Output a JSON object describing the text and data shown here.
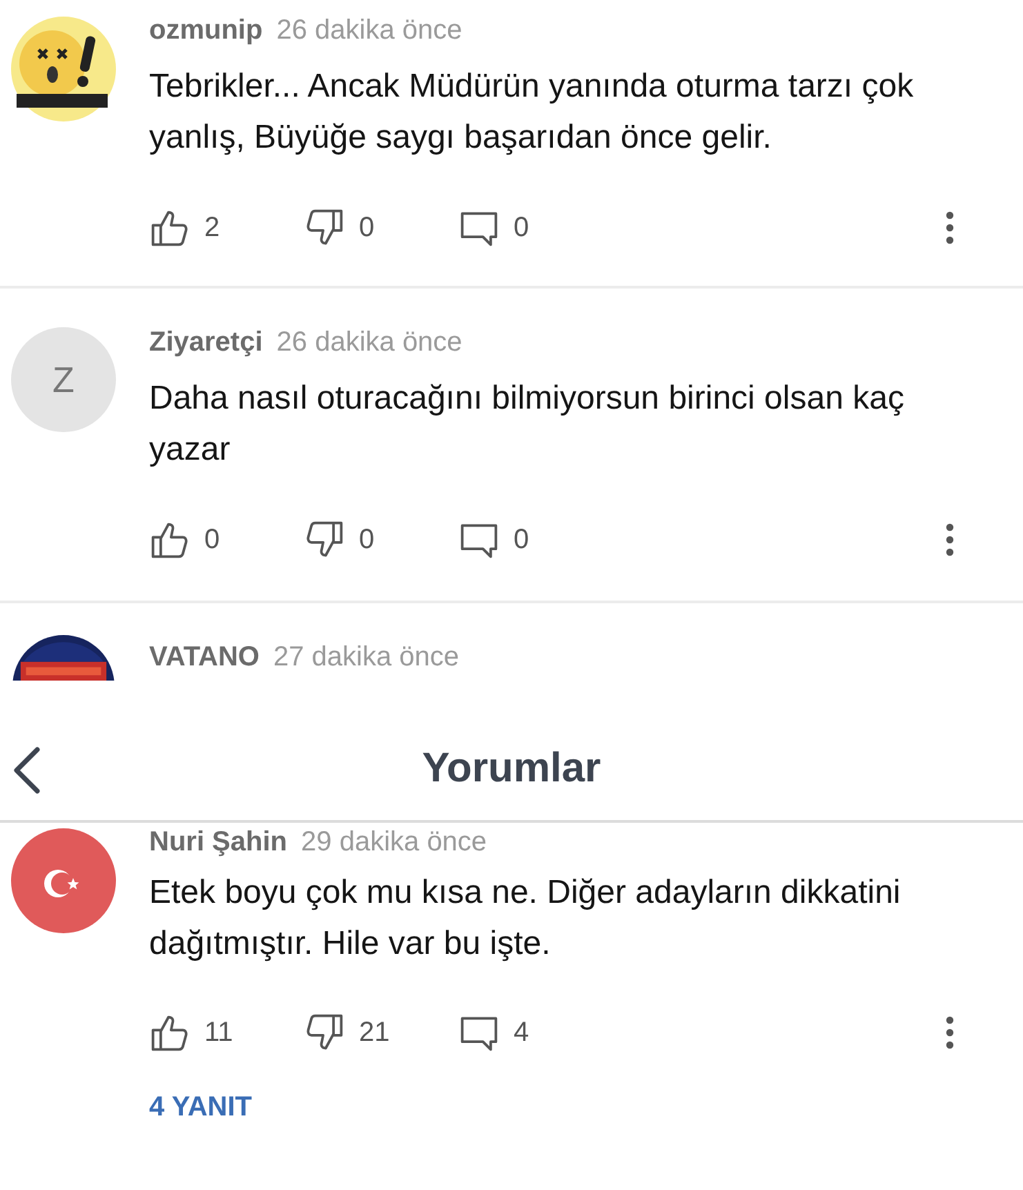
{
  "comments": [
    {
      "author": "ozmunip",
      "time": "26 dakika önce",
      "text": "Tebrikler... Ancak Müdürün yanında oturma tarzı çok yanlış, Büyüğe saygı başarıdan önce gelir.",
      "likes": "2",
      "dislikes": "0",
      "replies": "0"
    },
    {
      "author": "Ziyaretçi",
      "time": "26 dakika önce",
      "avatar": {
        "kind": "letter",
        "letter": "Z"
      },
      "text": "Daha nasıl oturacağını bilmiyorsun birinci olsan kaç yazar",
      "likes": "0",
      "dislikes": "0",
      "replies": "0"
    }
  ],
  "partial_comment": {
    "author": "VATANO",
    "time": "27 dakika önce"
  },
  "header": {
    "title": "Yorumlar"
  },
  "comment": {
    "author": "Nuri Şahin",
    "time": "29 dakika önce",
    "avatar": {
      "kind": "flag"
    },
    "text": "Etek boyu çok mu kısa ne. Diğer adayların dikkatini dağıtmıştır. Hile var bu işte.",
    "likes": "11",
    "dislikes": "21",
    "replies": "4",
    "replies_link": "4 YANIT"
  }
}
